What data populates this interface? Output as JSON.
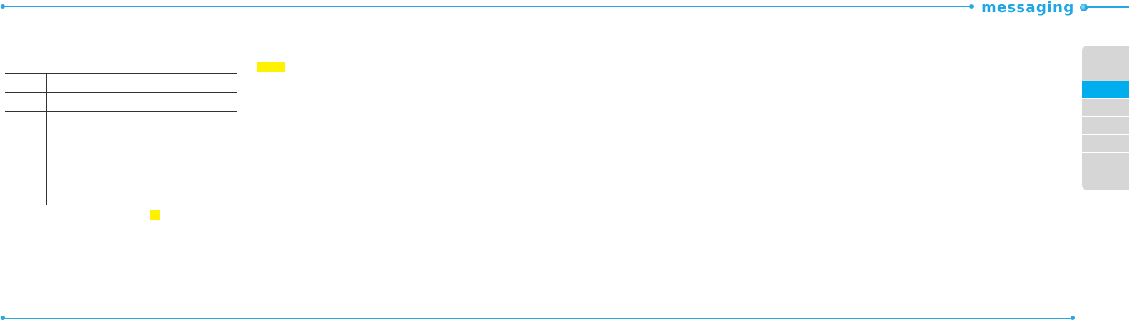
{
  "header": {
    "section_title": "messaging",
    "accent_color": "#29a8e0",
    "title_color": "#1ea7e3"
  },
  "table": {
    "rows": [
      {
        "key": "",
        "value": ""
      },
      {
        "key": "",
        "value": ""
      },
      {
        "key": "",
        "value": ""
      }
    ]
  },
  "highlights": {
    "color": "#fff200",
    "count": 2
  },
  "side_tabs": {
    "items": [
      {
        "label": "",
        "active": false
      },
      {
        "label": "",
        "active": false
      },
      {
        "label": "",
        "active": true
      },
      {
        "label": "",
        "active": false
      },
      {
        "label": "",
        "active": false
      },
      {
        "label": "",
        "active": false
      },
      {
        "label": "",
        "active": false
      },
      {
        "label": "",
        "active": false
      }
    ],
    "active_color": "#00aeef",
    "inactive_color": "#d6d6d6"
  }
}
